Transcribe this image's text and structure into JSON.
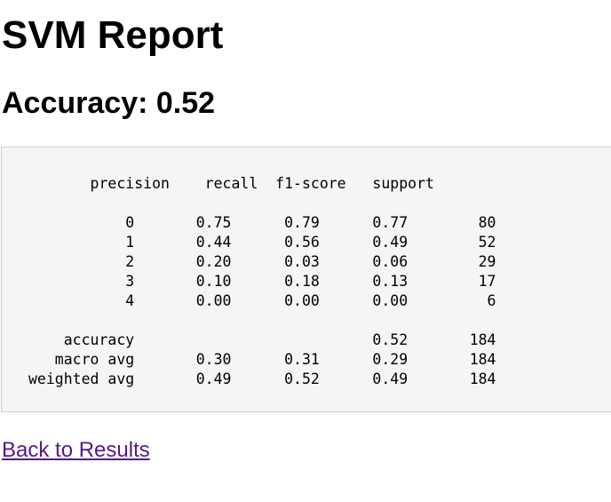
{
  "page": {
    "title": "SVM Report",
    "accuracy_heading": "Accuracy: 0.52"
  },
  "report": {
    "text": "       precision    recall  f1-score   support\n\n           0       0.75      0.79      0.77        80\n           1       0.44      0.56      0.49        52\n           2       0.20      0.03      0.06        29\n           3       0.10      0.18      0.13        17\n           4       0.00      0.00      0.00         6\n\n    accuracy                           0.52       184\n   macro avg       0.30      0.31      0.29       184\nweighted avg       0.49      0.52      0.49       184"
  },
  "nav": {
    "back_label": "Back to Results"
  },
  "colors": {
    "link_visited": "#551a8b",
    "report_background": "#f5f5f5",
    "report_border": "#cccccc"
  }
}
